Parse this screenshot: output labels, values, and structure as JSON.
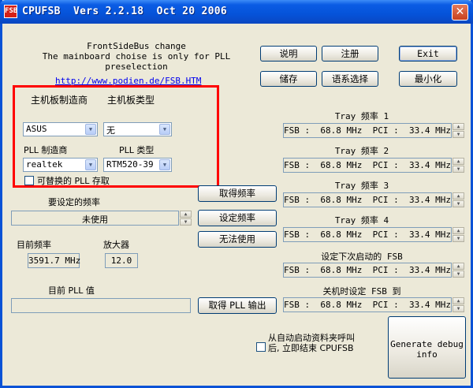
{
  "window": {
    "title": "CPUFSB  Vers 2.2.18  Oct 20 2006",
    "icon_text": "FSB",
    "close_glyph": "✕"
  },
  "header": {
    "line1": "FrontSideBus change",
    "line2": "The mainboard choise is only for PLL",
    "line3": "preselection",
    "url": "http://www.podien.de/FSB.HTM"
  },
  "top_buttons": {
    "help": "说明",
    "register": "注册",
    "exit": "Exit",
    "save": "储存",
    "language": "语系选择",
    "minimize": "最小化"
  },
  "board": {
    "maker_label": "主机板制造商",
    "type_label": "主机板类型",
    "maker_value": "ASUS",
    "type_value": "无",
    "pll_maker_label": "PLL 制造商",
    "pll_type_label": "PLL 类型",
    "pll_maker_value": "realtek",
    "pll_type_value": "RTM520-39",
    "alt_pll_label": "可替换的 PLL 存取"
  },
  "freq": {
    "target_label": "要设定的频率",
    "target_value": "未使用",
    "current_label": "目前频率",
    "multiplier_label": "放大器",
    "current_value": "3591.7 MHz",
    "multiplier_value": "12.0",
    "pll_value_label": "目前 PLL 值"
  },
  "middle_buttons": {
    "get_freq": "取得频率",
    "set_freq": "设定频率",
    "disabled": "无法使用",
    "get_pll": "取得 PLL 输出"
  },
  "tray": [
    {
      "label": "Tray 频率 1",
      "value": "FSB :  68.8 MHz  PCI :  33.4 MHz"
    },
    {
      "label": "Tray 频率 2",
      "value": "FSB :  68.8 MHz  PCI :  33.4 MHz"
    },
    {
      "label": "Tray 频率 3",
      "value": "FSB :  68.8 MHz  PCI :  33.4 MHz"
    },
    {
      "label": "Tray 频率 4",
      "value": "FSB :  68.8 MHz  PCI :  33.4 MHz"
    }
  ],
  "next_start": {
    "label": "设定下次启动的 FSB",
    "value": "FSB :  68.8 MHz  PCI :  33.4 MHz"
  },
  "shutdown": {
    "label": "关机时设定 FSB 到",
    "value": "FSB :  68.8 MHz  PCI :  33.4 MHz"
  },
  "autostart": {
    "line1": "从自动启动资料夹呼叫",
    "line2": "后, 立即结束 CPUFSB"
  },
  "debug_button": {
    "line1": "Generate debug",
    "line2": "info"
  },
  "colors": {
    "highlight_box": "#ff0000",
    "title_bar": "#0553d9",
    "window_bg": "#ece9d8"
  }
}
